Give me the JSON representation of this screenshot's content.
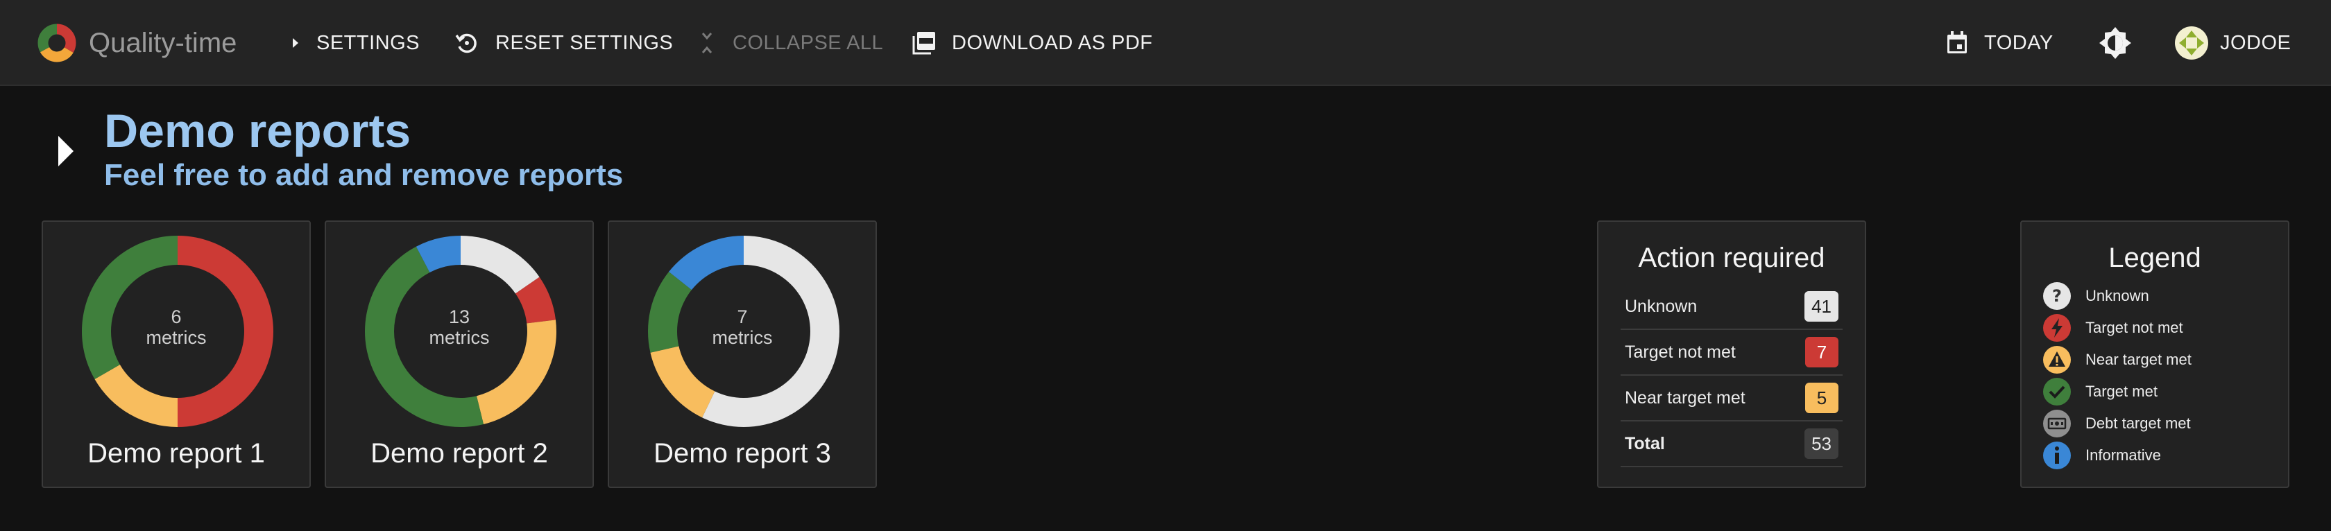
{
  "app": {
    "name": "Quality-time"
  },
  "toolbar": {
    "settings_label": "Settings",
    "reset_label": "Reset settings",
    "collapse_label": "Collapse all",
    "download_label": "Download as PDF",
    "today_label": "Today",
    "user_label": "JODOE"
  },
  "header": {
    "title": "Demo reports",
    "subtitle": "Feel free to add and remove reports"
  },
  "colors": {
    "unknown": "#e6e6e6",
    "target_not_met": "#cc3a35",
    "near_target_met": "#f8bd5e",
    "target_met": "#3f7f3c",
    "debt_target_met": "#8f8f8f",
    "informative": "#3a87d6",
    "title": "#9cc7f0"
  },
  "reports": [
    {
      "name": "Demo report 1",
      "count": "6",
      "unit": "metrics",
      "segments": [
        {
          "status": "target_not_met",
          "value": 3
        },
        {
          "status": "near_target_met",
          "value": 1
        },
        {
          "status": "target_met",
          "value": 2
        }
      ]
    },
    {
      "name": "Demo report 2",
      "count": "13",
      "unit": "metrics",
      "segments": [
        {
          "status": "unknown",
          "value": 2
        },
        {
          "status": "target_not_met",
          "value": 1
        },
        {
          "status": "near_target_met",
          "value": 3
        },
        {
          "status": "target_met",
          "value": 6
        },
        {
          "status": "informative",
          "value": 1
        }
      ]
    },
    {
      "name": "Demo report 3",
      "count": "7",
      "unit": "metrics",
      "segments": [
        {
          "status": "unknown",
          "value": 4
        },
        {
          "status": "near_target_met",
          "value": 1
        },
        {
          "status": "target_met",
          "value": 1
        },
        {
          "status": "informative",
          "value": 1
        }
      ]
    }
  ],
  "action_required": {
    "title": "Action required",
    "rows": [
      {
        "label": "Unknown",
        "value": "41",
        "style": "unknown"
      },
      {
        "label": "Target not met",
        "value": "7",
        "style": "red"
      },
      {
        "label": "Near target met",
        "value": "5",
        "style": "yellow"
      },
      {
        "label": "Total",
        "value": "53",
        "style": "grey"
      }
    ]
  },
  "legend": {
    "title": "Legend",
    "items": [
      {
        "label": "Unknown",
        "icon": "question-icon",
        "color": "#e6e6e6"
      },
      {
        "label": "Target not met",
        "icon": "bolt-icon",
        "color": "#cc3a35"
      },
      {
        "label": "Near target met",
        "icon": "warning-icon",
        "color": "#f8bd5e"
      },
      {
        "label": "Target met",
        "icon": "check-icon",
        "color": "#3f7f3c"
      },
      {
        "label": "Debt target met",
        "icon": "money-icon",
        "color": "#8f8f8f"
      },
      {
        "label": "Informative",
        "icon": "info-icon",
        "color": "#3a87d6"
      }
    ]
  }
}
